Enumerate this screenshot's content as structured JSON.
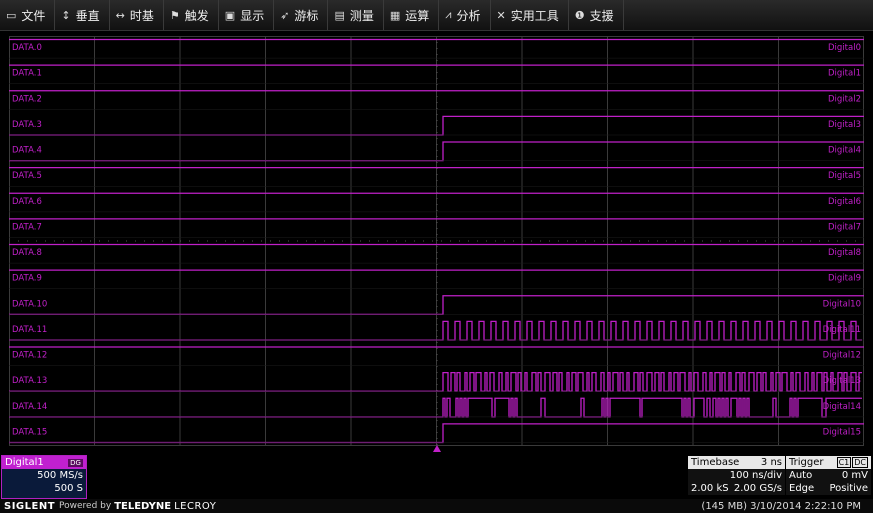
{
  "menu": [
    {
      "icon": "file-icon",
      "glyph": "▭",
      "label": "文件"
    },
    {
      "icon": "vertical-icon",
      "glyph": "↕",
      "label": "垂直"
    },
    {
      "icon": "timebase-icon",
      "glyph": "↔",
      "label": "时基"
    },
    {
      "icon": "trigger-icon",
      "glyph": "⚑",
      "label": "触发"
    },
    {
      "icon": "display-icon",
      "glyph": "▣",
      "label": "显示"
    },
    {
      "icon": "cursor-icon",
      "glyph": "➶",
      "label": "游标"
    },
    {
      "icon": "measure-icon",
      "glyph": "▤",
      "label": "测量"
    },
    {
      "icon": "math-icon",
      "glyph": "▦",
      "label": "运算"
    },
    {
      "icon": "analysis-icon",
      "glyph": "⩘",
      "label": "分析"
    },
    {
      "icon": "tools-icon",
      "glyph": "✕",
      "label": "实用工具"
    },
    {
      "icon": "support-icon",
      "glyph": "❶",
      "label": "支援"
    }
  ],
  "colors": {
    "trace": "#c020c8",
    "grid": "#3a3a3a",
    "dots": "#555555"
  },
  "channels": [
    {
      "left": "DATA.0",
      "right": "Digital0",
      "pattern": "high"
    },
    {
      "left": "DATA.1",
      "right": "Digital1",
      "pattern": "high"
    },
    {
      "left": "DATA.2",
      "right": "Digital2",
      "pattern": "high"
    },
    {
      "left": "DATA.3",
      "right": "Digital3",
      "pattern": "rise"
    },
    {
      "left": "DATA.4",
      "right": "Digital4",
      "pattern": "rise"
    },
    {
      "left": "DATA.5",
      "right": "Digital5",
      "pattern": "high"
    },
    {
      "left": "DATA.6",
      "right": "Digital6",
      "pattern": "high"
    },
    {
      "left": "DATA.7",
      "right": "Digital7",
      "pattern": "high"
    },
    {
      "left": "DATA.8",
      "right": "Digital8",
      "pattern": "high"
    },
    {
      "left": "DATA.9",
      "right": "Digital9",
      "pattern": "high"
    },
    {
      "left": "DATA.10",
      "right": "Digital10",
      "pattern": "rise"
    },
    {
      "left": "DATA.11",
      "right": "Digital11",
      "pattern": "clock"
    },
    {
      "left": "DATA.12",
      "right": "Digital12",
      "pattern": "high"
    },
    {
      "left": "DATA.13",
      "right": "Digital13",
      "pattern": "dense"
    },
    {
      "left": "DATA.14",
      "right": "Digital14",
      "pattern": "burst"
    },
    {
      "left": "DATA.15",
      "right": "Digital15",
      "pattern": "rise"
    }
  ],
  "channel_panel": {
    "name": "Digital1",
    "badge": "DG",
    "rate": "500 MS/s",
    "points": "500 S"
  },
  "timebase": {
    "title": "Timebase",
    "delay": "3 ns",
    "scale": "100 ns/div",
    "samples": "2.00 kS",
    "rate": "2.00 GS/s"
  },
  "trigger": {
    "title": "Trigger",
    "source": "C1",
    "coupling": "DC",
    "mode": "Auto",
    "level": "0 mV",
    "type": "Edge",
    "slope": "Positive"
  },
  "footer": {
    "brand": "SIGLENT",
    "powered": "Powered by",
    "maker": "TELEDYNE",
    "maker2": "LECROY",
    "status": "(145 MB) 3/10/2014 2:22:10 PM"
  }
}
